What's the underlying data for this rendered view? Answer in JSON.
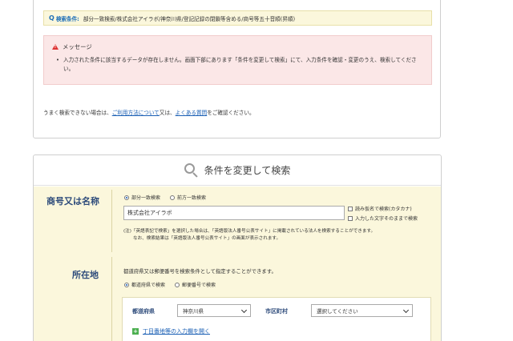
{
  "result": {
    "condition_label": "検索条件:",
    "condition_text": "部分一致検索/株式会社アイラボ/神奈川県/登記記録の閉鎖等含める/商号等五十音順(昇順)",
    "message_title": "メッセージ",
    "message_text": "入力された条件に該当するデータが存在しません。画面下部にあります「条件を変更して検索」にて、入力条件を確認・変更のうえ、検索してください。",
    "help_prefix": "うまく検索できない場合は、",
    "help_link1": "ご利用方法について",
    "help_mid": "又は、",
    "help_link2": "よくある質問",
    "help_suffix": "をご確認ください。"
  },
  "search": {
    "heading": "条件を変更して検索",
    "name_label": "商号又は名称",
    "match_options": [
      "部分一致検索",
      "前方一致検索"
    ],
    "match_selected": 0,
    "name_value": "株式会社アイラボ",
    "checkbox_options": [
      "読み仮名で検索(カタカナ)",
      "入力した文字そのままで検索"
    ],
    "note_line1": "(注)「英語表記で検索」を選択した場合は、「英語版法人番号公表サイト」に掲載されている法人を検索することができます。",
    "note_line2": "なお、検索結果は「英語版法人番号公表サイト」の画面が表示されます。",
    "location_label": "所在地",
    "location_hint": "都道府県又は郵便番号を検索条件として指定することができます。",
    "location_options": [
      "都道府県で検索",
      "郵便番号で検索"
    ],
    "location_selected": 0,
    "pref_label": "都道府県",
    "pref_value": "神奈川県",
    "city_label": "市区町村",
    "city_value": "選択してください",
    "expand_link": "丁目番地等の入力欄を開く"
  },
  "colors": {
    "accent": "#1a5fb4",
    "condition_bg": "#fbf7dc",
    "message_bg": "#fbe7e7",
    "label_navy": "#2c4a7a",
    "warning": "#dd3333"
  }
}
